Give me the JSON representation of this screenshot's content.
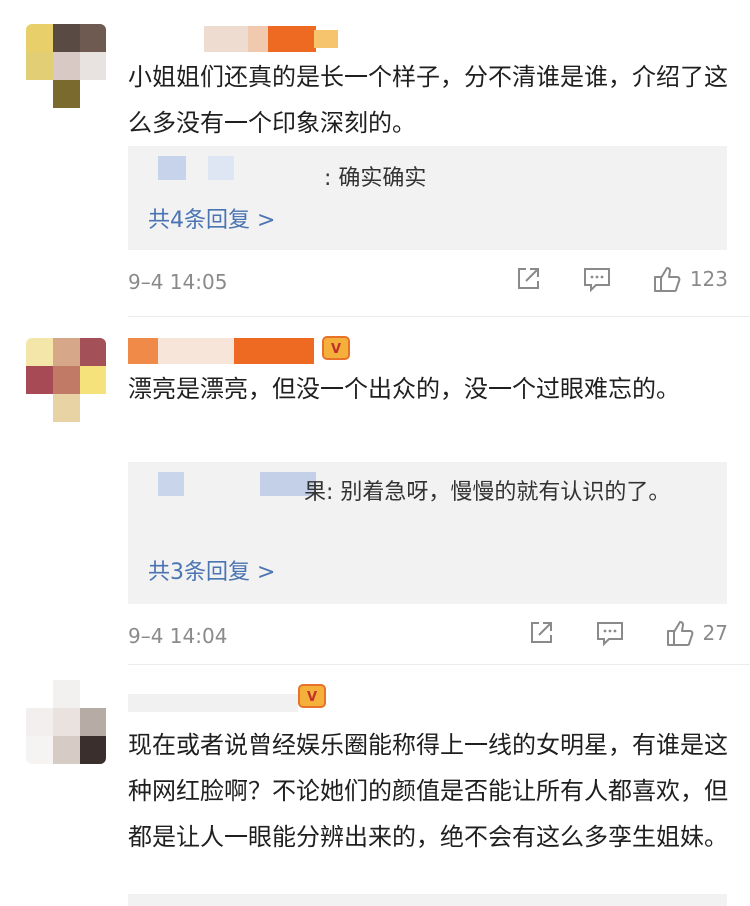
{
  "comments": [
    {
      "text": "小姐姐们还真的是长一个样子，分不清谁是谁，介绍了这么多没有一个印象深刻的。",
      "reply": {
        "text": ": 确实确实",
        "more": "共4条回复 >"
      },
      "time": "9–4 14:05",
      "likes": "123"
    },
    {
      "vip_badge": "V",
      "text": "漂亮是漂亮，但没一个出众的，没一个过眼难忘的。",
      "reply": {
        "text": "果: 别着急呀，慢慢的就有认识的了。",
        "more": "共3条回复 >"
      },
      "time": "9–4 14:04",
      "likes": "27"
    },
    {
      "vip_badge": "V",
      "text": "现在或者说曾经娱乐圈能称得上一线的女明星，有谁是这种网红脸啊？不论她们的颜值是否能让所有人都喜欢，但都是让人一眼能分辨出来的，绝不会有这么多孪生姐妹。"
    }
  ],
  "colors": {
    "link": "#4a74b2",
    "meta": "#8a8a8a",
    "reply_bg": "#f2f2f2"
  },
  "icons": [
    "share-icon",
    "comment-icon",
    "like-icon"
  ]
}
